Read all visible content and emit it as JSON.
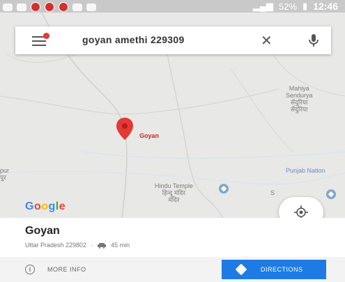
{
  "status_bar": {
    "battery": "52%",
    "time": "12:46"
  },
  "search": {
    "query": "goyan amethi 229309"
  },
  "map": {
    "labels": {
      "goyan": "Goyan",
      "mahiya": "Mahiya",
      "sendurya": "Sendurya",
      "sendurya_hi1": "सेंदुरिया",
      "sendurya_hi2": "सेंदुरिया",
      "pur": "pur",
      "pur_hi": "पुर",
      "punjab": "Punjab Nation",
      "hindu_temple": "Hindu Temple",
      "hindu_temple_hi1": "हिन्दू मंदिर",
      "hindu_temple_hi2": "मंदिर",
      "poi_s": "S"
    },
    "google_logo": [
      "G",
      "o",
      "o",
      "g",
      "l",
      "e"
    ]
  },
  "place": {
    "name": "Goyan",
    "address": "Uttar Pradesh 229802",
    "separator": "·",
    "drive_time": "45 min"
  },
  "actions": {
    "more_info": "MORE INFO",
    "directions": "DIRECTIONS"
  },
  "colors": {
    "accent": "#1e7be5",
    "pin": "#e53935"
  }
}
